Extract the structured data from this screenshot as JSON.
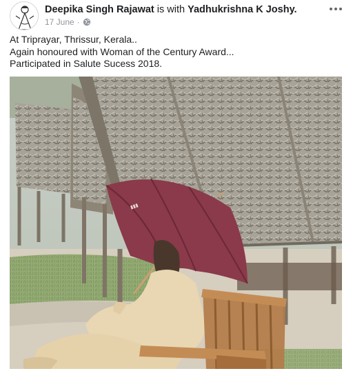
{
  "post": {
    "author": "Deepika Singh Rajawat",
    "connector": "is with",
    "tagged": "Yadhukrishna K Joshy.",
    "date": "17 June",
    "separator": "·",
    "privacy_icon": "globe-icon",
    "more_icon": "more-options-icon",
    "lines": [
      "At Triprayar, Thrissur, Kerala..",
      "Again honoured with Woman of the Century Award...",
      "Participated in Salute Sucess 2018."
    ]
  },
  "colors": {
    "text": "#1c1e21",
    "secondary_text": "#90949c",
    "umbrella": "#8a3a4a",
    "thatch": "#a9a59b",
    "ground": "#d7d0c3",
    "grass": "#8fae70",
    "chair": "#b07a45",
    "dress": "#e9d8b5"
  }
}
